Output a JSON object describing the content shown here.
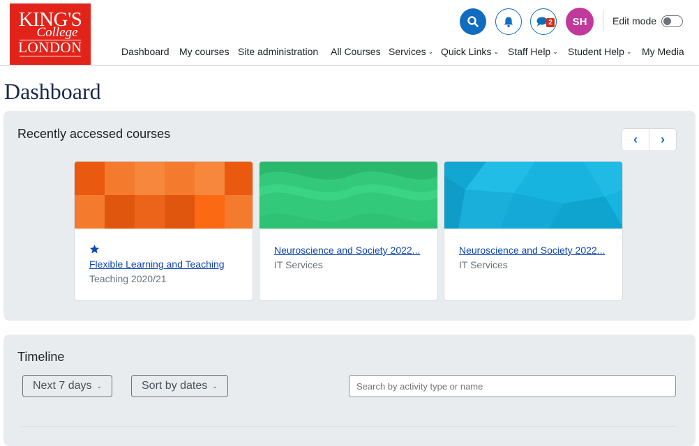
{
  "brand": {
    "logo_line1": "KING'S",
    "logo_line2": "College",
    "logo_line3": "LONDON",
    "color": "#e2231a"
  },
  "header": {
    "avatar_initials": "SH",
    "message_count": "2",
    "edit_mode_label": "Edit mode",
    "edit_mode_on": false,
    "icons": [
      "search-icon",
      "bell-icon",
      "chat-icon"
    ]
  },
  "nav": {
    "items": [
      {
        "label": "Dashboard",
        "dropdown": false
      },
      {
        "label": "My courses",
        "dropdown": false
      },
      {
        "label": "Site administration",
        "dropdown": false
      },
      {
        "label": "All Courses",
        "dropdown": false
      },
      {
        "label": "Services",
        "dropdown": true
      },
      {
        "label": "Quick Links",
        "dropdown": true
      },
      {
        "label": "Staff Help",
        "dropdown": true
      },
      {
        "label": "Student Help",
        "dropdown": true
      },
      {
        "label": "My Media",
        "dropdown": false
      }
    ]
  },
  "page": {
    "title": "Dashboard"
  },
  "recent": {
    "title": "Recently accessed courses",
    "cards": [
      {
        "title": "Flexible Learning and Teaching",
        "category": "Teaching 2020/21",
        "starred": true,
        "image_color": "#f26b1d"
      },
      {
        "title": "Neuroscience and Society 2022...",
        "category": "IT Services",
        "starred": false,
        "image_color": "#33c97a"
      },
      {
        "title": "Neuroscience and Society 2022...",
        "category": "IT Services",
        "starred": false,
        "image_color": "#18b4e0"
      }
    ]
  },
  "timeline": {
    "title": "Timeline",
    "filter_label": "Next 7 days",
    "sort_label": "Sort by dates",
    "search_placeholder": "Search by activity type or name"
  },
  "colors": {
    "primary": "#0f6cbf",
    "panel_bg": "#e8ecee",
    "avatar_bg": "#c0399b"
  }
}
